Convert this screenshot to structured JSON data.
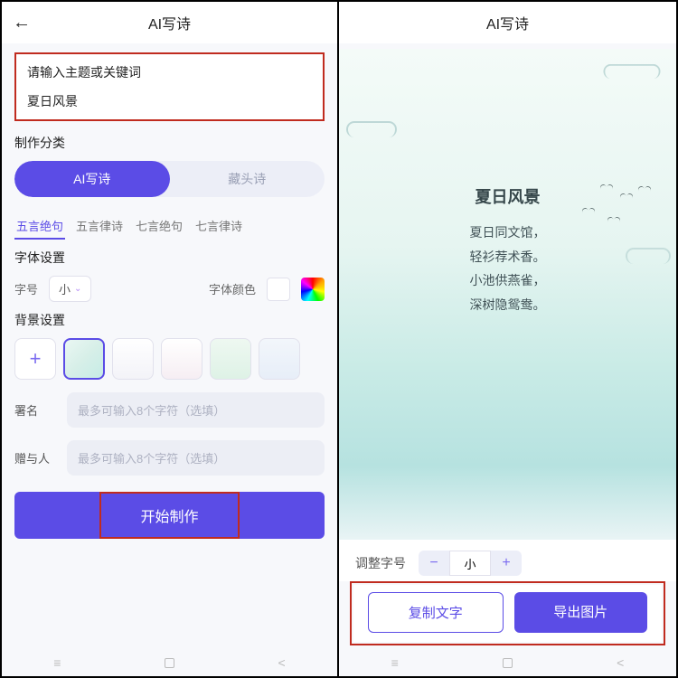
{
  "left": {
    "header_title": "AI写诗",
    "input_label": "请输入主题或关键词",
    "input_value": "夏日风景",
    "category_title": "制作分类",
    "segments": [
      "AI写诗",
      "藏头诗"
    ],
    "segment_active": 0,
    "tabs": [
      "五言绝句",
      "五言律诗",
      "七言绝句",
      "七言律诗"
    ],
    "tab_active": 0,
    "font_section": "字体设置",
    "font_size_label": "字号",
    "font_size_value": "小",
    "font_color_label": "字体颜色",
    "bg_section": "背景设置",
    "sign_label": "署名",
    "sign_placeholder": "最多可输入8个字符（选填）",
    "give_label": "赠与人",
    "give_placeholder": "最多可输入8个字符（选填）",
    "primary_btn": "开始制作"
  },
  "right": {
    "header_title": "AI写诗",
    "poem_title": "夏日风景",
    "poem_lines": [
      "夏日同文馆，",
      "轻衫荐术香。",
      "小池供燕雀，",
      "深树隐鸳鸯。"
    ],
    "adjust_label": "调整字号",
    "adjust_value": "小",
    "copy_btn": "复制文字",
    "export_btn": "导出图片"
  },
  "nav": {
    "menu": "≡",
    "back": "<"
  }
}
